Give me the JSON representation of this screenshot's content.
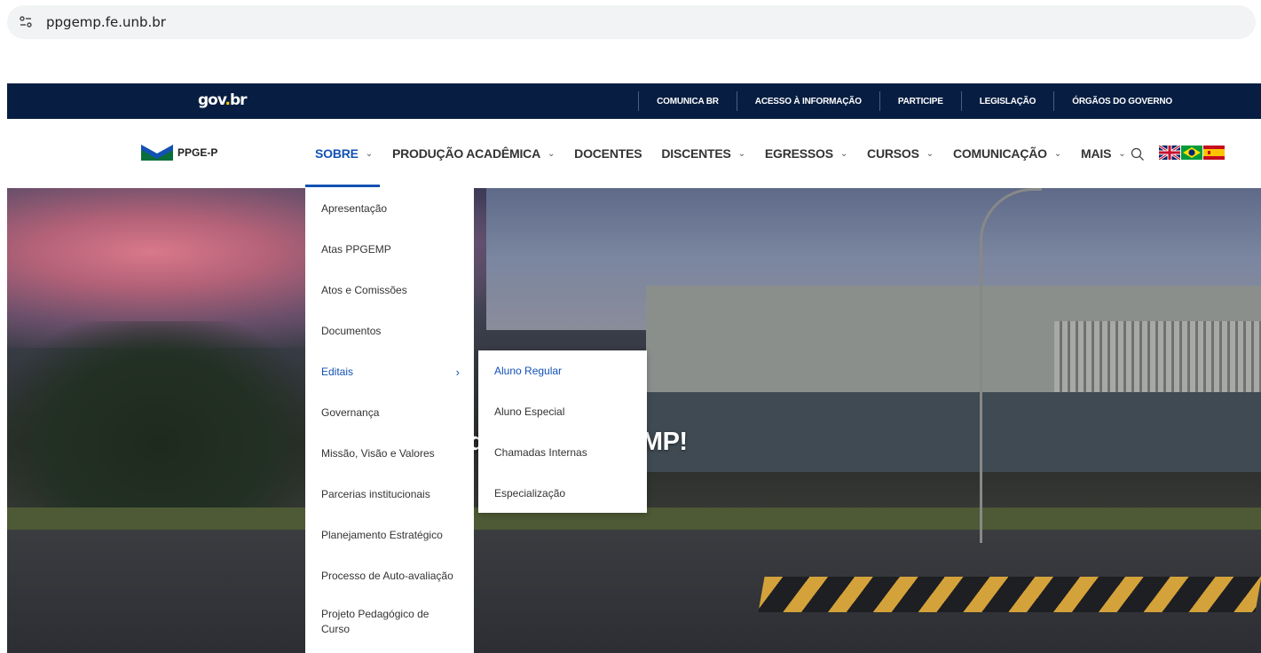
{
  "browser": {
    "url": "ppgemp.fe.unb.br"
  },
  "govbar": {
    "logo": "gov.br",
    "links": [
      "COMUNICA BR",
      "ACESSO À INFORMAÇÃO",
      "PARTICIPE",
      "LEGISLAÇÃO",
      "ÓRGÃOS DO GOVERNO"
    ]
  },
  "nav": {
    "brand": "PPGE-P",
    "items": [
      {
        "label": "SOBRE",
        "chevron": true
      },
      {
        "label": "PRODUÇÃO ACADÊMICA",
        "chevron": true
      },
      {
        "label": "DOCENTES",
        "chevron": false
      },
      {
        "label": "DISCENTES",
        "chevron": true
      },
      {
        "label": "EGRESSOS",
        "chevron": true
      },
      {
        "label": "CURSOS",
        "chevron": true
      },
      {
        "label": "COMUNICAÇÃO",
        "chevron": true
      },
      {
        "label": "MAIS",
        "chevron": true
      }
    ],
    "flags": [
      "english-flag-icon",
      "portuguese-flag-icon",
      "spanish-flag-icon"
    ]
  },
  "dropdown": {
    "items": [
      "Apresentação",
      "Atas PPGEMP",
      "Atos e Comissões",
      "Documentos",
      "Editais",
      "Governança",
      "Missão, Visão e Valores",
      "Parcerias institucionais",
      "Planejamento Estratégico",
      "Processo de Auto-avaliação",
      "Projeto Pedagógico de Curso"
    ],
    "arrow": "›"
  },
  "submenu": {
    "items": [
      "Aluno Regular",
      "Aluno Especial",
      "Chamadas Internas",
      "Especialização"
    ]
  },
  "hero": {
    "title": "do(a) ao PPGEMP!"
  },
  "colors": {
    "govbar": "#071d41",
    "accent": "#1351b4"
  }
}
